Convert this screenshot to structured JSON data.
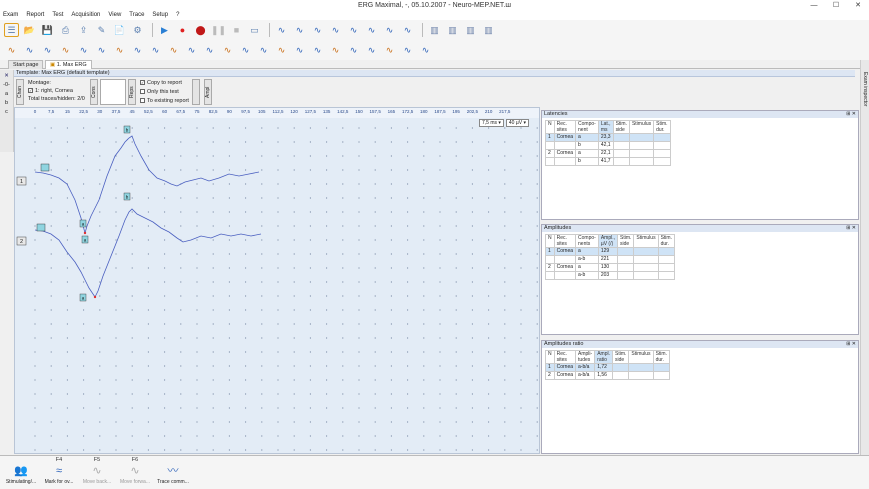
{
  "window": {
    "title": "ERG Maximal, -, 05.10.2007 - Neuro-MEP.NET.ш",
    "min": "—",
    "max": "☐",
    "close": "✕"
  },
  "menu": [
    "Exam",
    "Report",
    "Test",
    "Acquisition",
    "View",
    "Trace",
    "Setup",
    "?"
  ],
  "toolbar1": [
    "list-icon",
    "folder-icon",
    "save-icon",
    "print-icon",
    "export-icon",
    "edit-icon",
    "doc-icon",
    "settings-icon",
    "play-icon",
    "record-icon",
    "stop-icon",
    "pause-icon",
    "square-icon",
    "monitor-icon",
    "wave-icon",
    "wave-icon",
    "wave-icon",
    "wave-icon",
    "wave-icon",
    "wave-icon",
    "wave-icon",
    "wave-icon",
    "layout-icon",
    "layout-icon",
    "layout-icon",
    "layout-icon"
  ],
  "toolbar2_count": 24,
  "tabs": {
    "start": "Start page",
    "exam": "1. Max ERG"
  },
  "left_strip": [
    "✕",
    "-0-",
    "a",
    "b",
    "c"
  ],
  "template_bar": "Template: Max ERG (default template)",
  "options": {
    "chan_label": "Chan",
    "montage_label": "Montage:",
    "montage_item": "1: right, Cornea",
    "total_traces": "Total traces/hidden: 2/0",
    "cons_label": "Cons",
    "reps_label": "Reps",
    "copy_to_report": "Copy to report",
    "only_this_test": "Only this test",
    "to_existing": "To existing report",
    "ampl_label": "Ampl"
  },
  "ruler_ticks": [
    "0",
    "7,5",
    "15",
    "22,5",
    "30",
    "37,5",
    "45",
    "52,5",
    "60",
    "67,5",
    "75",
    "82,5",
    "90",
    "97,5",
    "105",
    "112,5",
    "120",
    "127,5",
    "135",
    "142,5",
    "150",
    "157,5",
    "165",
    "172,5",
    "180",
    "187,5",
    "195",
    "202,5",
    "210",
    "217,5"
  ],
  "scale": {
    "time": "7,5 ms ▾",
    "ampl": "40 µV ▾"
  },
  "traces": [
    {
      "num": "1",
      "a": {
        "x": 12,
        "y": 19
      },
      "b": {
        "x": 41,
        "y": -80
      }
    },
    {
      "num": "2",
      "a": {
        "x": 10,
        "y": 17
      },
      "b": {
        "x": 41,
        "y": -50
      }
    }
  ],
  "latencies": {
    "title": "Latencies",
    "headers": [
      "N",
      "Rec. sites",
      "Compo-nent",
      "Lat., ms",
      "Stim. side",
      "Stimulus",
      "Stim. dur."
    ],
    "rows": [
      [
        "1",
        "Cornea",
        "a",
        "23,3",
        "",
        "",
        ""
      ],
      [
        "",
        "",
        "b",
        "42,1",
        "",
        "",
        ""
      ],
      [
        "2",
        "Cornea",
        "a",
        "22,1",
        "",
        "",
        ""
      ],
      [
        "",
        "",
        "b",
        "41,7",
        "",
        "",
        ""
      ]
    ]
  },
  "amplitudes": {
    "title": "Amplitudes",
    "headers": [
      "N",
      "Rec. sites",
      "Compo-nents",
      "Ampl., µV (/)",
      "Stim. side",
      "Stimulus",
      "Stim. dur."
    ],
    "rows": [
      [
        "1",
        "Cornea",
        "a",
        "129",
        "",
        "",
        ""
      ],
      [
        "",
        "",
        "a-b",
        "221",
        "",
        "",
        ""
      ],
      [
        "2",
        "Cornea",
        "a",
        "130",
        "",
        "",
        ""
      ],
      [
        "",
        "",
        "a-b",
        "203",
        "",
        "",
        ""
      ]
    ]
  },
  "ratio": {
    "title": "Amplitudes ratio",
    "headers": [
      "N",
      "Rec. sites",
      "Ampli-tudes",
      "Ampl. ratio",
      "Stim. side",
      "Stimulus",
      "Stim. dur."
    ],
    "rows": [
      [
        "1",
        "Cornea",
        "a-b/a",
        "1,72",
        "",
        "",
        ""
      ],
      [
        "2",
        "Cornea",
        "a-b/a",
        "1,56",
        "",
        "",
        ""
      ]
    ]
  },
  "panel_buttons": "⊞ ✕",
  "right_strip": "Exam inspector",
  "fkeys": [
    {
      "key": "",
      "label": "Stimulating/...",
      "icon": "👥",
      "disabled": false
    },
    {
      "key": "F4",
      "label": "Mark for ov...",
      "icon": "≈",
      "disabled": false
    },
    {
      "key": "F5",
      "label": "Move back...",
      "icon": "∿",
      "disabled": true
    },
    {
      "key": "F6",
      "label": "Move forwa...",
      "icon": "∿",
      "disabled": true
    },
    {
      "key": "",
      "label": "Trace comm...",
      "icon": "〰",
      "disabled": false
    }
  ]
}
